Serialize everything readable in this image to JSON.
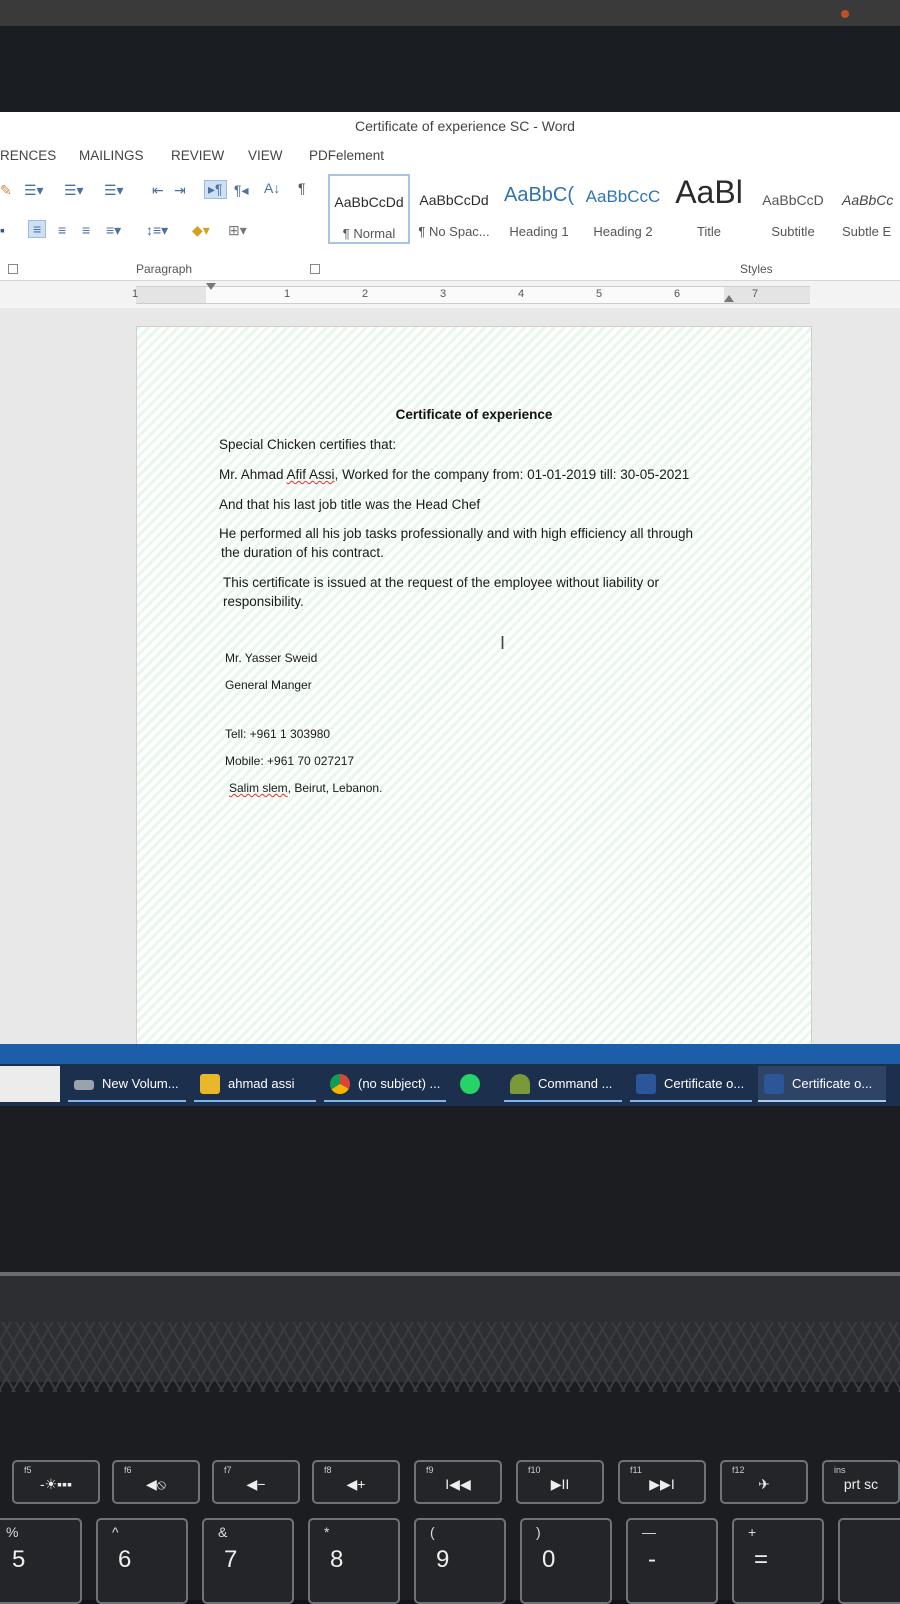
{
  "window": {
    "title": "Certificate of experience SC - Word"
  },
  "tabs": [
    "RENCES",
    "MAILINGS",
    "REVIEW",
    "VIEW",
    "PDFelement"
  ],
  "ribbon": {
    "paragraph_label": "Paragraph",
    "styles_label": "Styles",
    "styles": [
      {
        "preview": "AaBbCcDd",
        "name": "¶ Normal"
      },
      {
        "preview": "AaBbCcDd",
        "name": "¶ No Spac..."
      },
      {
        "preview": "AaBbC(",
        "name": "Heading 1"
      },
      {
        "preview": "AaBbCcC",
        "name": "Heading 2"
      },
      {
        "preview": "AaBl",
        "name": "Title"
      },
      {
        "preview": "AaBbCcD",
        "name": "Subtitle"
      },
      {
        "preview": "AaBbCc",
        "name": "Subtle E"
      }
    ]
  },
  "ruler": {
    "numbers": [
      "1",
      "1",
      "2",
      "3",
      "4",
      "5",
      "6",
      "7"
    ]
  },
  "document": {
    "title": "Certificate of experience",
    "intro": "Special Chicken certifies that:",
    "line1": {
      "prefix": "Mr. Ahmad ",
      "surname": "Afif Assi",
      "rest": ", Worked for the company from: 01-01-2019 till: 30-05-2021"
    },
    "line2": "And that his last job title was the Head Chef",
    "para1_line1": "He performed all his job tasks professionally and with high efficiency all through",
    "para1_line2": "the duration of his contract.",
    "para2_line1": "This certificate is issued at the request of the employee without liability or",
    "para2_line2": "responsibility.",
    "signer_name": "Mr. Yasser Sweid",
    "signer_title": "General Manger",
    "tel": "Tell: +961 1 303980",
    "mobile": "Mobile: +961 70 027217",
    "address_underlined": "Salim slem",
    "address_rest": ", Beirut, Lebanon."
  },
  "taskbar": {
    "items": [
      {
        "label": "New Volum...",
        "icon": "drive-icon"
      },
      {
        "label": "ahmad assi",
        "icon": "folder-icon"
      },
      {
        "label": "(no subject) ...",
        "icon": "chrome-icon"
      },
      {
        "label": "",
        "icon": "whatsapp-icon"
      },
      {
        "label": "Command ...",
        "icon": "command-icon"
      },
      {
        "label": "Certificate o...",
        "icon": "word-icon"
      },
      {
        "label": "Certificate o...",
        "icon": "word-icon"
      }
    ]
  },
  "keyboard": {
    "fkeys": [
      {
        "fn": "f5",
        "sym": "-☀▪▪▪"
      },
      {
        "fn": "f6",
        "sym": "◀⦸"
      },
      {
        "fn": "f7",
        "sym": "◀−"
      },
      {
        "fn": "f8",
        "sym": "◀+"
      },
      {
        "fn": "f9",
        "sym": "I◀◀"
      },
      {
        "fn": "f10",
        "sym": "▶II"
      },
      {
        "fn": "f11",
        "sym": "▶▶I"
      },
      {
        "fn": "f12",
        "sym": "✈"
      },
      {
        "fn": "ins",
        "sym": "prt sc"
      }
    ],
    "numkeys": [
      {
        "top": "%",
        "main": "5"
      },
      {
        "top": "^",
        "main": "6"
      },
      {
        "top": "&",
        "main": "7"
      },
      {
        "top": "*",
        "main": "8"
      },
      {
        "top": "(",
        "main": "9"
      },
      {
        "top": ")",
        "main": "0"
      },
      {
        "top": "—",
        "main": "-"
      },
      {
        "top": "+",
        "main": "="
      }
    ]
  },
  "colors": {
    "taskbar": "#1c2f4c",
    "accent": "#1c5ea8",
    "page_tint": "#96dcaa"
  }
}
